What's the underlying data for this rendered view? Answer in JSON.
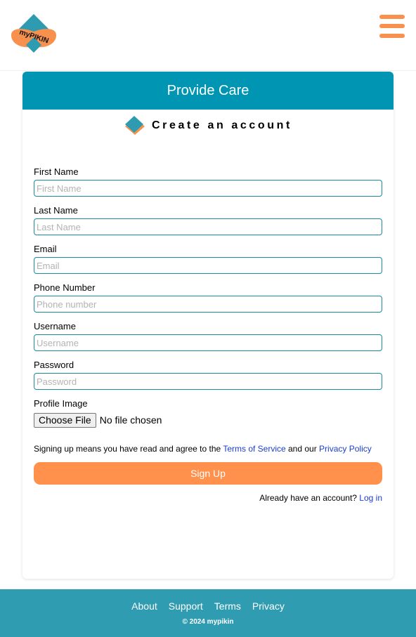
{
  "header": {
    "logo_text": "myPIKIN",
    "menu_icon": "hamburger-menu-icon"
  },
  "card": {
    "title": "Provide Care",
    "subtitle": "Create an account",
    "subtitle_icon": "diamond-icon"
  },
  "form": {
    "fields": [
      {
        "label": "First Name",
        "placeholder": "First Name",
        "value": ""
      },
      {
        "label": "Last Name",
        "placeholder": "Last Name",
        "value": ""
      },
      {
        "label": "Email",
        "placeholder": "Email",
        "value": ""
      },
      {
        "label": "Phone Number",
        "placeholder": "Phone number",
        "value": ""
      },
      {
        "label": "Username",
        "placeholder": "Username",
        "value": ""
      },
      {
        "label": "Password",
        "placeholder": "Password",
        "value": ""
      }
    ],
    "profile_image": {
      "label": "Profile Image",
      "button_label": "Choose File",
      "status": "No file chosen"
    },
    "terms": {
      "prefix": "Signing up means you have read and agree to the ",
      "terms_link": "Terms of Service",
      "middle": " and our ",
      "privacy_link": "Privacy Policy"
    },
    "signup_label": "Sign Up",
    "login_prompt": "Already have an account? ",
    "login_link": "Log in"
  },
  "footer": {
    "links": [
      "About",
      "Support",
      "Terms",
      "Privacy"
    ],
    "copyright": "© 2024 mypikin"
  },
  "colors": {
    "brand_teal": "#0096b3",
    "footer_teal": "#2f9cb2",
    "accent_orange": "#ff914d",
    "input_border": "#1b8a9c",
    "link_blue": "#1a3cd6"
  }
}
